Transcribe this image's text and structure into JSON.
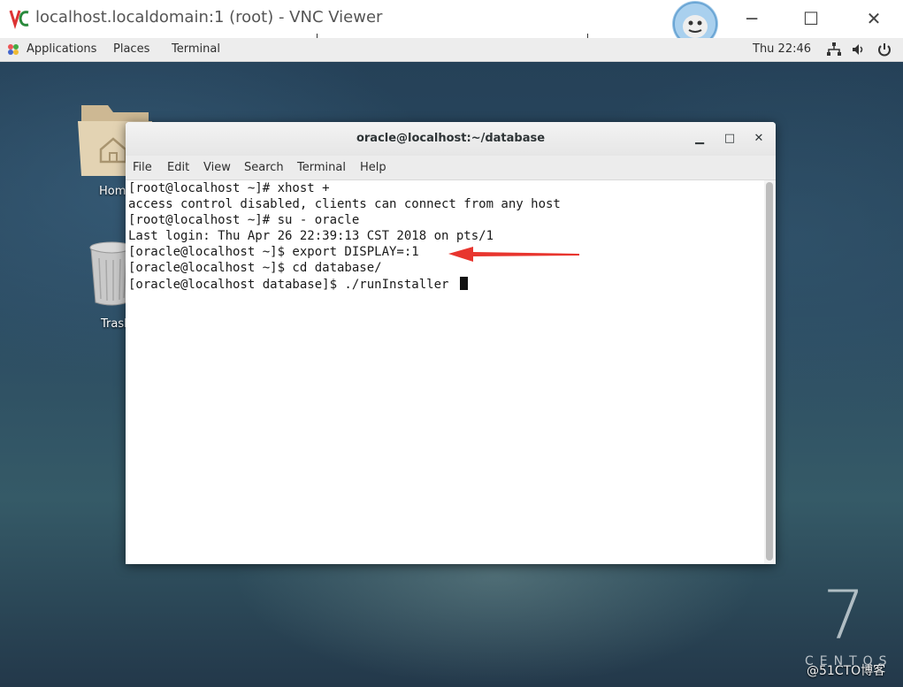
{
  "vnc": {
    "title": "localhost.localdomain:1 (root) - VNC Viewer",
    "minimize_label": "─",
    "maximize_label": "☐",
    "close_label": "✕"
  },
  "panel": {
    "applications": "Applications",
    "places": "Places",
    "terminal": "Terminal",
    "clock": "Thu 22:46"
  },
  "desktop": {
    "home_label": "Hom",
    "trash_label": "Trasl",
    "centos_version": "7",
    "centos_word": "CENTOS",
    "watermark": "@51CTO博客"
  },
  "terminal": {
    "title": "oracle@localhost:~/database",
    "menu": [
      "File",
      "Edit",
      "View",
      "Search",
      "Terminal",
      "Help"
    ],
    "lines": [
      "[root@localhost ~]# xhost +",
      "access control disabled, clients can connect from any host",
      "[root@localhost ~]# su - oracle",
      "Last login: Thu Apr 26 22:39:13 CST 2018 on pts/1",
      "[oracle@localhost ~]$ export DISPLAY=:1",
      "[oracle@localhost ~]$ cd database/",
      "[oracle@localhost database]$ ./runInstaller "
    ],
    "min_label": "▁",
    "max_label": "□",
    "close_label": "✕"
  },
  "colors": {
    "annotation_arrow": "#e8352e"
  },
  "icons": [
    "vnc-logo-icon",
    "applications-icon",
    "network-icon",
    "volume-icon",
    "power-icon",
    "home-folder-icon",
    "trash-icon"
  ]
}
